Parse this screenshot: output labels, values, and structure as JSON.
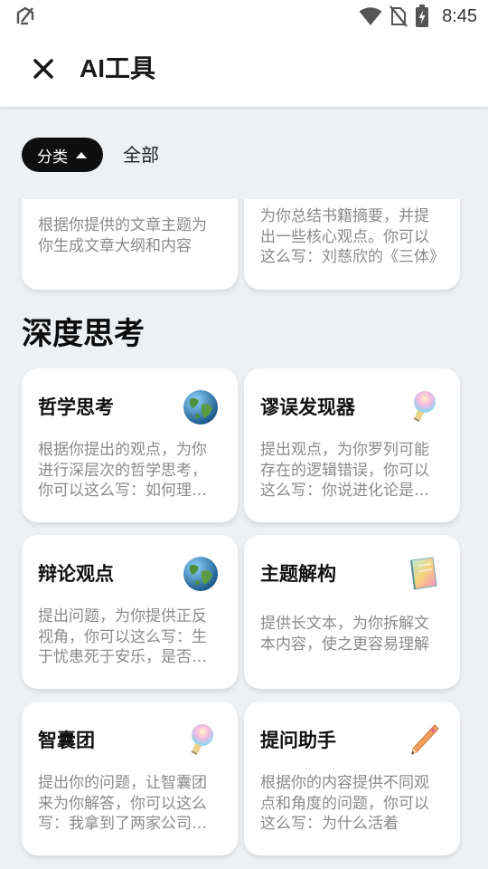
{
  "status_bar": {
    "time": "8:45",
    "icons": [
      "app-notification-icon",
      "wifi-icon",
      "no-sim-icon",
      "battery-charging-icon"
    ]
  },
  "header": {
    "close_icon": "close-icon",
    "title": "AI工具"
  },
  "filter": {
    "chip_label": "分类",
    "chip_icon": "caret-up-icon",
    "all_label": "全部"
  },
  "partial_cards": [
    {
      "desc": "根据你提供的文章主题为你生成文章大纲和内容"
    },
    {
      "desc": "为你总结书籍摘要，并提出一些核心观点。你可以这么写：刘慈欣的《三体》"
    }
  ],
  "section": {
    "title": "深度思考"
  },
  "cards": [
    {
      "title": "哲学思考",
      "icon": "globe-icon",
      "desc": "根据你提出的观点，为你进行深层次的哲学思考，你可以这么写：如何理解人生的意义"
    },
    {
      "title": "谬误发现器",
      "icon": "lightbulb-icon",
      "desc": "提出观点，为你罗列可能存在的逻辑错误，你可以这么写：你说进化论是错的"
    },
    {
      "title": "辩论观点",
      "icon": "globe-icon",
      "desc": "提出问题，为你提供正反视角，你可以这么写：生于忧患死于安乐，是否正确"
    },
    {
      "title": "主题解构",
      "icon": "notebook-icon",
      "desc": "提供长文本，为你拆解文本内容，使之更容易理解"
    },
    {
      "title": "智囊团",
      "icon": "lightbulb-icon",
      "desc": "提出你的问题，让智囊团来为你解答，你可以这么写：我拿到了两家公司的offer"
    },
    {
      "title": "提问助手",
      "icon": "pencil-icon",
      "desc": "根据你的内容提供不同观点和角度的问题，你可以这么写：为什么活着"
    }
  ]
}
